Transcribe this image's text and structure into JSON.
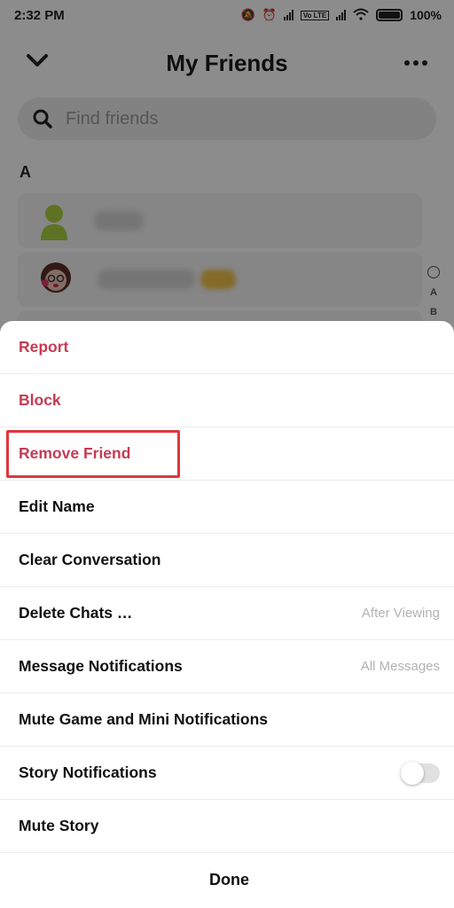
{
  "status_bar": {
    "time": "2:32 PM",
    "battery": "100%",
    "volte_label": "Vo LTE"
  },
  "header": {
    "title": "My Friends",
    "back_icon": "chevron-down-icon",
    "more_icon": "more-horizontal-icon"
  },
  "search": {
    "placeholder": "Find friends",
    "icon": "search-icon"
  },
  "friends": {
    "section_letter": "A"
  },
  "index_strip": [
    "A",
    "B"
  ],
  "sheet": {
    "items": [
      {
        "label": "Report",
        "value": "",
        "style": "danger"
      },
      {
        "label": "Block",
        "value": "",
        "style": "danger"
      },
      {
        "label": "Remove Friend",
        "value": "",
        "style": "danger",
        "highlighted": true
      },
      {
        "label": "Edit Name",
        "value": ""
      },
      {
        "label": "Clear Conversation",
        "value": ""
      },
      {
        "label": "Delete Chats …",
        "value": "After Viewing"
      },
      {
        "label": "Message Notifications",
        "value": "All Messages"
      },
      {
        "label": "Mute Game and Mini Notifications",
        "value": ""
      },
      {
        "label": "Story Notifications",
        "value": "",
        "toggle": "off"
      },
      {
        "label": "Mute Story",
        "value": ""
      }
    ],
    "done_label": "Done"
  },
  "colors": {
    "danger": "#c73a53",
    "highlight": "#e0363d",
    "dim_overlay": "rgba(0,0,0,0.45)"
  }
}
